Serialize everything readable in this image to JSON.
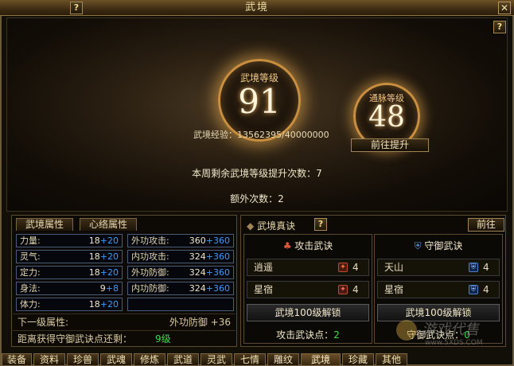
{
  "window": {
    "title": "武境",
    "help": "?",
    "close": "✕"
  },
  "hero": {
    "level_label": "武境等级",
    "level_value": "91",
    "meridian_label": "通脉等级",
    "meridian_value": "48",
    "exp_text": "武境经验：13562395/40000000",
    "goto_button": "前往提升",
    "weekly_text": "本周剩余武境等级提升次数：7",
    "extra_text": "额外次数：2"
  },
  "left_panel": {
    "tabs": [
      "武境属性",
      "心络属性"
    ],
    "stats_left": [
      {
        "name": "力量:",
        "base": "18",
        "bonus": "+20"
      },
      {
        "name": "灵气:",
        "base": "18",
        "bonus": "+20"
      },
      {
        "name": "定力:",
        "base": "18",
        "bonus": "+20"
      },
      {
        "name": "身法:",
        "base": "9",
        "bonus": "+8"
      },
      {
        "name": "体力:",
        "base": "18",
        "bonus": "+20"
      }
    ],
    "stats_right": [
      {
        "name": "外功攻击:",
        "base": "360",
        "bonus": "+360"
      },
      {
        "name": "内功攻击:",
        "base": "324",
        "bonus": "+360"
      },
      {
        "name": "外功防御:",
        "base": "324",
        "bonus": "+360"
      },
      {
        "name": "内功防御:",
        "base": "324",
        "bonus": "+360"
      }
    ],
    "next_label": "下一级属性:",
    "next_value": "外功防御 +36",
    "distance_text": "距离获得守御武诀点还剩：",
    "distance_value": "9级"
  },
  "right_panel": {
    "title": "武境真诀",
    "goto_button": "前往",
    "attack": {
      "title": "攻击武诀",
      "items": [
        {
          "name": "逍遥",
          "count": "4"
        },
        {
          "name": "星宿",
          "count": "4"
        }
      ],
      "unlock": "武境100级解锁",
      "points_label": "攻击武诀点：",
      "points_value": "2"
    },
    "defense": {
      "title": "守御武诀",
      "items": [
        {
          "name": "天山",
          "count": "4"
        },
        {
          "name": "星宿",
          "count": "4"
        }
      ],
      "unlock": "武境100级解锁",
      "points_label": "守御武诀点：",
      "points_value": "0"
    }
  },
  "bottom_tabs": [
    "装备",
    "资料",
    "珍兽",
    "武魂",
    "修炼",
    "武道",
    "灵武",
    "七情",
    "雕纹",
    "武境",
    "珍藏",
    "其他"
  ],
  "active_tab": "武境",
  "watermark": {
    "text": "游戏代售",
    "url": "www.5XDS.COM"
  }
}
